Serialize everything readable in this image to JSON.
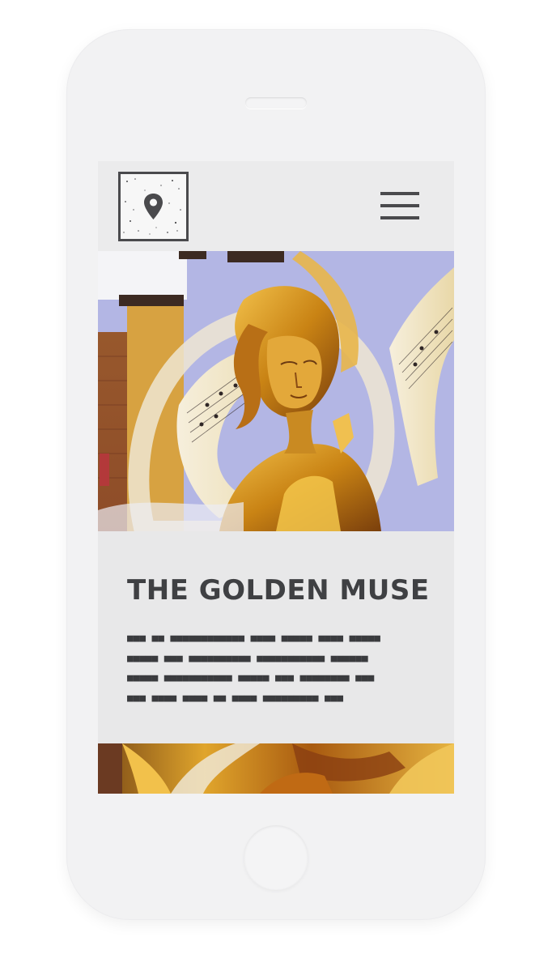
{
  "device": {
    "type": "mobile-phone-mockup"
  },
  "header": {
    "logo_icon": "map-pin-icon",
    "menu_icon": "hamburger-menu-icon"
  },
  "hero": {
    "image": "golden-muse-mural"
  },
  "article": {
    "title": "THE GOLDEN MUSE",
    "text_lines": [
      "■■■ ■■ ■■■■■■■■■■■■ ■■■■ ■■■■■ ■■■■ ■■■■■",
      "■■■■■ ■■■ ■■■■■■■■■■ ■■■■■■■■■■■ ■■■■■■",
      "■■■■■ ■■■■■■■■■■■ ■■■■■ ■■■ ■■■■■■■■ ■■■",
      "■■■ ■■■■ ■■■■ ■■ ■■■■ ■■■■■■■■■ ■■■"
    ]
  },
  "next_card": {
    "image": "golden-mural-detail"
  },
  "colors": {
    "dark_gray": "#4a4a4d",
    "screen_bg": "#e8e8e9",
    "gold": "#d99a1c",
    "sky_lavender": "#b4b8e6"
  }
}
